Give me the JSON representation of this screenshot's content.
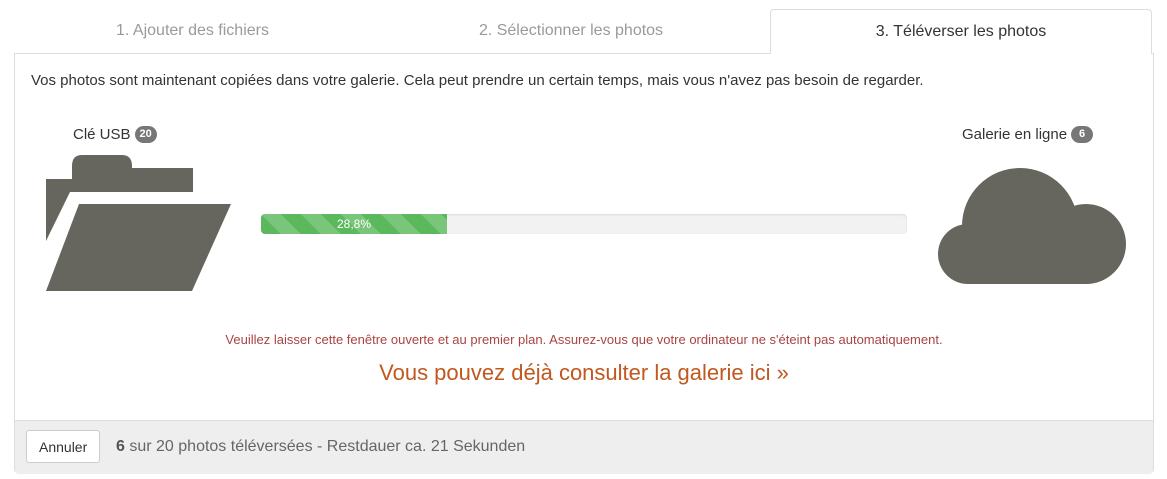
{
  "tabs": [
    {
      "label": "1. Ajouter des fichiers",
      "active": false
    },
    {
      "label": "2. Sélectionner les photos",
      "active": false
    },
    {
      "label": "3. Téléverser les photos",
      "active": true
    }
  ],
  "intro_text": "Vos photos sont maintenant copiées dans votre galerie. Cela peut prendre un certain temps, mais vous n'avez pas besoin de regarder.",
  "source": {
    "label": "Clé USB",
    "count": "20",
    "icon": "folder-open-icon"
  },
  "destination": {
    "label": "Galerie en ligne",
    "count": "6",
    "icon": "cloud-icon"
  },
  "progress": {
    "percent": 28.8,
    "label": "28,8%"
  },
  "warning_text": "Veuillez laisser cette fenêtre ouverte et au premier plan. Assurez-vous que votre ordinateur ne s'éteint pas automatiquement.",
  "gallery_link": "Vous pouvez déjà consulter la galerie ici »",
  "footer": {
    "cancel_label": "Annuler",
    "uploaded_count": "6",
    "status_rest": " sur 20 photos téléversées - Restdauer ca. 21 Sekunden"
  },
  "colors": {
    "progress_fill": "#5cb85c",
    "icon": "#66665e",
    "warning": "#a94442",
    "link": "#c0581f"
  }
}
